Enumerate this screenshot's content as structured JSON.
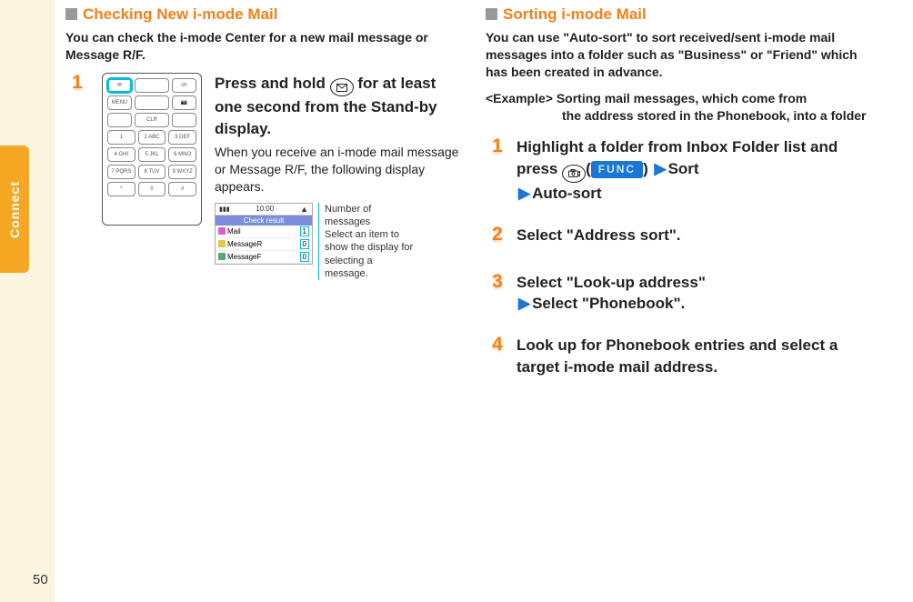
{
  "sidebar": {
    "label": "Connect"
  },
  "page_number": "50",
  "left": {
    "title": "Checking New i-mode Mail",
    "intro": "You can check the i-mode Center for a new mail message or Message R/F.",
    "step1": {
      "num": "1",
      "title_pre": "Press and hold ",
      "title_post": " for at least one second from the Stand-by display.",
      "desc": "When you receive an i-mode mail message or Message R/F, the following display appears."
    },
    "result_screen": {
      "time": "10:00",
      "title": "Check result",
      "rows": [
        {
          "label": "Mail",
          "value": "1",
          "icon_color": "#d95fce"
        },
        {
          "label": "MessageR",
          "value": "0",
          "icon_color": "#e2c947"
        },
        {
          "label": "MessageF",
          "value": "0",
          "icon_color": "#5aa86e"
        }
      ]
    },
    "callout": {
      "line1": "Number of messages",
      "line2": "Select an item to show the display for selecting a message."
    },
    "phone_keys": {
      "top": [
        [
          "✉",
          "",
          "ch"
        ],
        [
          "MENU",
          "",
          "📷"
        ],
        [
          "",
          "CLR",
          ""
        ]
      ],
      "numpad": [
        [
          "1",
          "2 ABC",
          "3 DEF"
        ],
        [
          "4 GHI",
          "5 JKL",
          "6 MNO"
        ],
        [
          "7 PQRS",
          "8 TUV",
          "9 WXYZ"
        ],
        [
          "*",
          "0",
          "#"
        ]
      ]
    }
  },
  "right": {
    "title": "Sorting i-mode Mail",
    "intro": "You can use \"Auto-sort\" to sort received/sent i-mode mail messages into a folder such as \"Business\" or \"Friend\" which has been created in advance.",
    "example_label": "<Example>",
    "example_text1": "Sorting mail messages, which come from",
    "example_text2": "the address stored in the Phonebook, into a folder",
    "steps": [
      {
        "num": "1",
        "title_line1_pre": "Highlight a folder from Inbox Folder list and press ",
        "title_paren_open": "(",
        "func": "FUNC",
        "title_paren_close": ")",
        "title_after_func": "Sort",
        "title_line2": "Auto-sort"
      },
      {
        "num": "2",
        "title": "Select \"Address sort\"."
      },
      {
        "num": "3",
        "title_line1": "Select \"Look-up address\"",
        "title_line2": "Select \"Phonebook\"."
      },
      {
        "num": "4",
        "title": "Look up for Phonebook entries and select a target i-mode mail address."
      }
    ]
  }
}
